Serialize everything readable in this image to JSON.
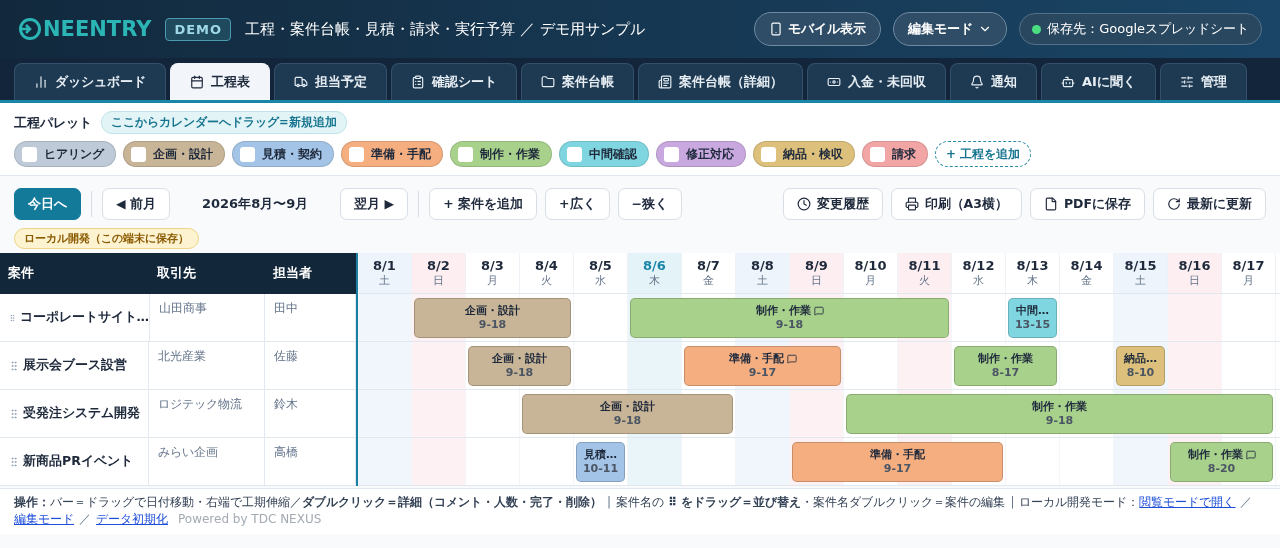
{
  "header": {
    "logo": "NEENTRY",
    "badge": "DEMO",
    "title": "工程・案件台帳・見積・請求・実行予算 ／ デモ用サンプル",
    "mobile_button": "モバイル表示",
    "mode_select": "編集モード",
    "save_target": "保存先：Googleスプレッドシート"
  },
  "tabs": [
    {
      "label": "ダッシュボード",
      "selected": false
    },
    {
      "label": "工程表",
      "selected": true
    },
    {
      "label": "担当予定",
      "selected": false
    },
    {
      "label": "確認シート",
      "selected": false
    },
    {
      "label": "案件台帳",
      "selected": false
    },
    {
      "label": "案件台帳（詳細）",
      "selected": false
    },
    {
      "label": "入金・未回収",
      "selected": false
    },
    {
      "label": "通知",
      "selected": false
    },
    {
      "label": "AIに聞く",
      "selected": false
    },
    {
      "label": "管理",
      "selected": false
    }
  ],
  "palette": {
    "title": "工程パレット",
    "hint": "ここからカレンダーへドラッグ=新規追加",
    "add": "+ 工程を追加",
    "chips": [
      {
        "label": "ヒアリング",
        "color": "#bfcad8",
        "checked": false
      },
      {
        "label": "企画・設計",
        "color": "#c8b496",
        "checked": false
      },
      {
        "label": "見積・契約",
        "color": "#a3c4e6",
        "checked": false
      },
      {
        "label": "準備・手配",
        "color": "#f4ae80",
        "checked": false
      },
      {
        "label": "制作・作業",
        "color": "#a8d18c",
        "checked": false
      },
      {
        "label": "中間確認",
        "color": "#7fd6e0",
        "checked": false
      },
      {
        "label": "修正対応",
        "color": "#c9a8e0",
        "checked": false
      },
      {
        "label": "納品・検収",
        "color": "#dcc07c",
        "checked": false
      },
      {
        "label": "請求",
        "color": "#f2a5a5",
        "checked": false
      }
    ]
  },
  "toolbar": {
    "today": "今日へ",
    "prev": "◀ 前月",
    "range": "2026年8月〜9月",
    "next": "翌月 ▶",
    "add_project": "+ 案件を追加",
    "wider": "+広く",
    "narrower": "−狭く",
    "history": "変更履歴",
    "print": "印刷（A3横）",
    "pdf": "PDFに保存",
    "refresh": "最新に更新"
  },
  "storage_badge": "ローカル開発（この端末に保存）",
  "table": {
    "columns": [
      "案件",
      "取引先",
      "担当者"
    ],
    "days": [
      {
        "date": "8/1",
        "weekday": "土",
        "kind": "saturday"
      },
      {
        "date": "8/2",
        "weekday": "日",
        "kind": "holiday"
      },
      {
        "date": "8/3",
        "weekday": "月",
        "kind": "weekday"
      },
      {
        "date": "8/4",
        "weekday": "火",
        "kind": "weekday"
      },
      {
        "date": "8/5",
        "weekday": "水",
        "kind": "weekday"
      },
      {
        "date": "8/6",
        "weekday": "木",
        "kind": "today"
      },
      {
        "date": "8/7",
        "weekday": "金",
        "kind": "weekday"
      },
      {
        "date": "8/8",
        "weekday": "土",
        "kind": "saturday"
      },
      {
        "date": "8/9",
        "weekday": "日",
        "kind": "holiday"
      },
      {
        "date": "8/10",
        "weekday": "月",
        "kind": "weekday"
      },
      {
        "date": "8/11",
        "weekday": "火",
        "kind": "holiday"
      },
      {
        "date": "8/12",
        "weekday": "水",
        "kind": "weekday"
      },
      {
        "date": "8/13",
        "weekday": "木",
        "kind": "weekday"
      },
      {
        "date": "8/14",
        "weekday": "金",
        "kind": "weekday"
      },
      {
        "date": "8/15",
        "weekday": "土",
        "kind": "saturday"
      },
      {
        "date": "8/16",
        "weekday": "日",
        "kind": "holiday"
      },
      {
        "date": "8/17",
        "weekday": "月",
        "kind": "weekday"
      }
    ],
    "rows": [
      {
        "project": "コーポレートサイト…",
        "client": "山田商事",
        "person": "田中",
        "bars": [
          {
            "label": "企画・設計",
            "time": "9-18",
            "color": "#c8b496",
            "comment": false
          },
          {
            "label": "制作・作業",
            "time": "9-18",
            "color": "#a8d18c",
            "comment": true
          },
          {
            "label": "中間…",
            "time": "13-15",
            "color": "#7fd6e0",
            "comment": false
          }
        ]
      },
      {
        "project": "展示会ブース設営",
        "client": "北光産業",
        "person": "佐藤",
        "bars": [
          {
            "label": "企画・設計",
            "time": "9-18",
            "color": "#c8b496",
            "comment": false
          },
          {
            "label": "準備・手配",
            "time": "9-17",
            "color": "#f4ae80",
            "comment": true
          },
          {
            "label": "制作・作業",
            "time": "8-17",
            "color": "#a8d18c",
            "comment": false
          },
          {
            "label": "納品…",
            "time": "8-10",
            "color": "#dcc07c",
            "comment": false
          }
        ]
      },
      {
        "project": "受発注システム開発",
        "client": "ロジテック物流",
        "person": "鈴木",
        "bars": [
          {
            "label": "企画・設計",
            "time": "9-18",
            "color": "#c8b496",
            "comment": false
          },
          {
            "label": "制作・作業",
            "time": "9-18",
            "color": "#a8d18c",
            "comment": false
          }
        ]
      },
      {
        "project": "新商品PRイベント",
        "client": "みらい企画",
        "person": "高橋",
        "bars": [
          {
            "label": "見積…",
            "time": "10-11",
            "color": "#a3c4e6",
            "comment": false
          },
          {
            "label": "準備・手配",
            "time": "9-17",
            "color": "#f4ae80",
            "comment": false
          },
          {
            "label": "制作・作業",
            "time": "8-20",
            "color": "#a8d18c",
            "comment": true
          }
        ]
      }
    ]
  },
  "footer": {
    "operations": "**操作：**バー＝ドラッグで日付移動・右端で工期伸縮／**ダブルクリック＝詳細（コメント・人数・完了・削除）**",
    "sep1": "|",
    "sorting": "案件名の **⠿ をドラッグ＝並び替え**・案件名ダブルクリック＝案件の編集",
    "sep2": "|",
    "local_label": "ローカル開発モード：",
    "links": [
      "閲覧モードで開く",
      "編集モード",
      "データ初期化"
    ],
    "link_sep": "／",
    "powered": "Powered by TDC NEXUS"
  }
}
